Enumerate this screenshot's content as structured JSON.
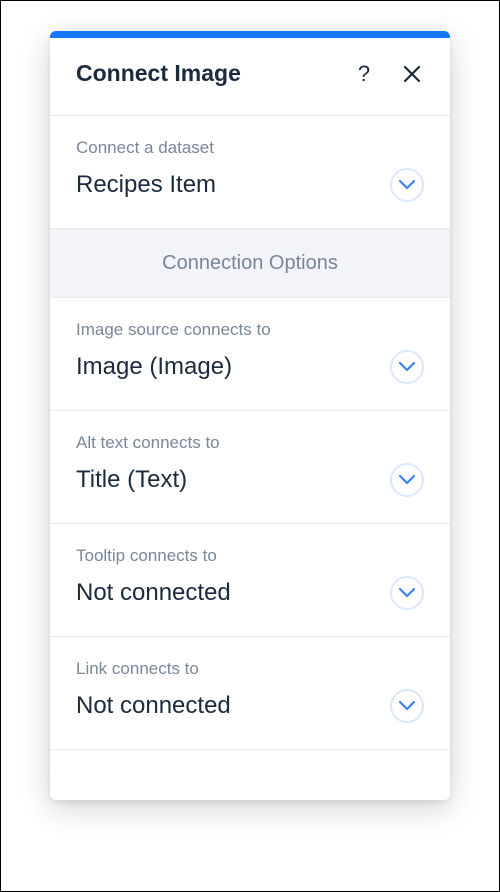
{
  "header": {
    "title": "Connect Image"
  },
  "dataset": {
    "label": "Connect a dataset",
    "value": "Recipes Item"
  },
  "connectionOptionsLabel": "Connection Options",
  "fields": [
    {
      "label": "Image source connects to",
      "value": "Image (Image)"
    },
    {
      "label": "Alt text connects to",
      "value": "Title (Text)"
    },
    {
      "label": "Tooltip connects to",
      "value": "Not connected"
    },
    {
      "label": "Link connects to",
      "value": "Not connected"
    }
  ]
}
